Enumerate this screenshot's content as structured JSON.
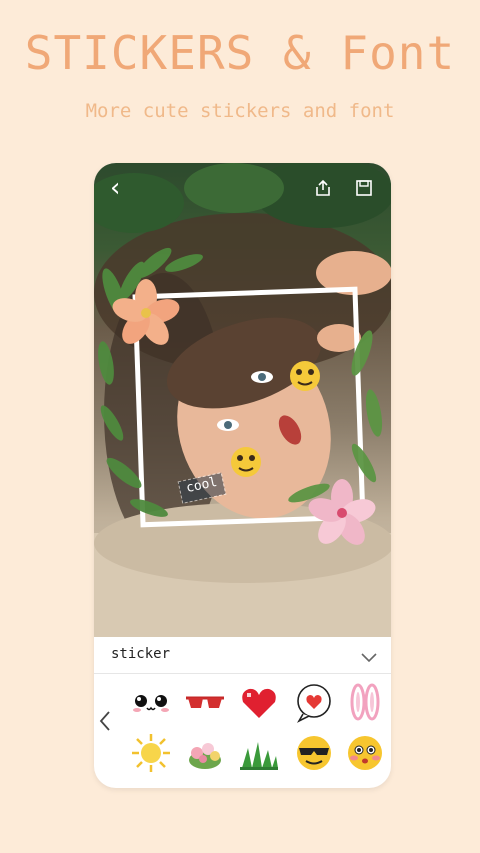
{
  "headline": "STICKERS & Font",
  "subline": "More cute stickers and font",
  "editor": {
    "toolbar": {
      "back_icon": "chevron-left-icon",
      "share_icon": "share-icon",
      "save_icon": "save-icon"
    },
    "photo_stickers": {
      "text_sticker": "cool"
    },
    "panel": {
      "title": "sticker",
      "collapse_icon": "chevron-down-icon"
    },
    "stickers": [
      "kawaii-eyes-sticker",
      "sunglasses-sticker",
      "pixel-heart-sticker",
      "heart-speech-bubble-sticker",
      "bunny-ears-sticker",
      "sun-sticker",
      "flower-bouquet-sticker",
      "grass-sticker",
      "cool-emoji-sticker",
      "shy-emoji-sticker"
    ]
  },
  "colors": {
    "background": "#fdebd8",
    "headline": "#f0a877"
  }
}
